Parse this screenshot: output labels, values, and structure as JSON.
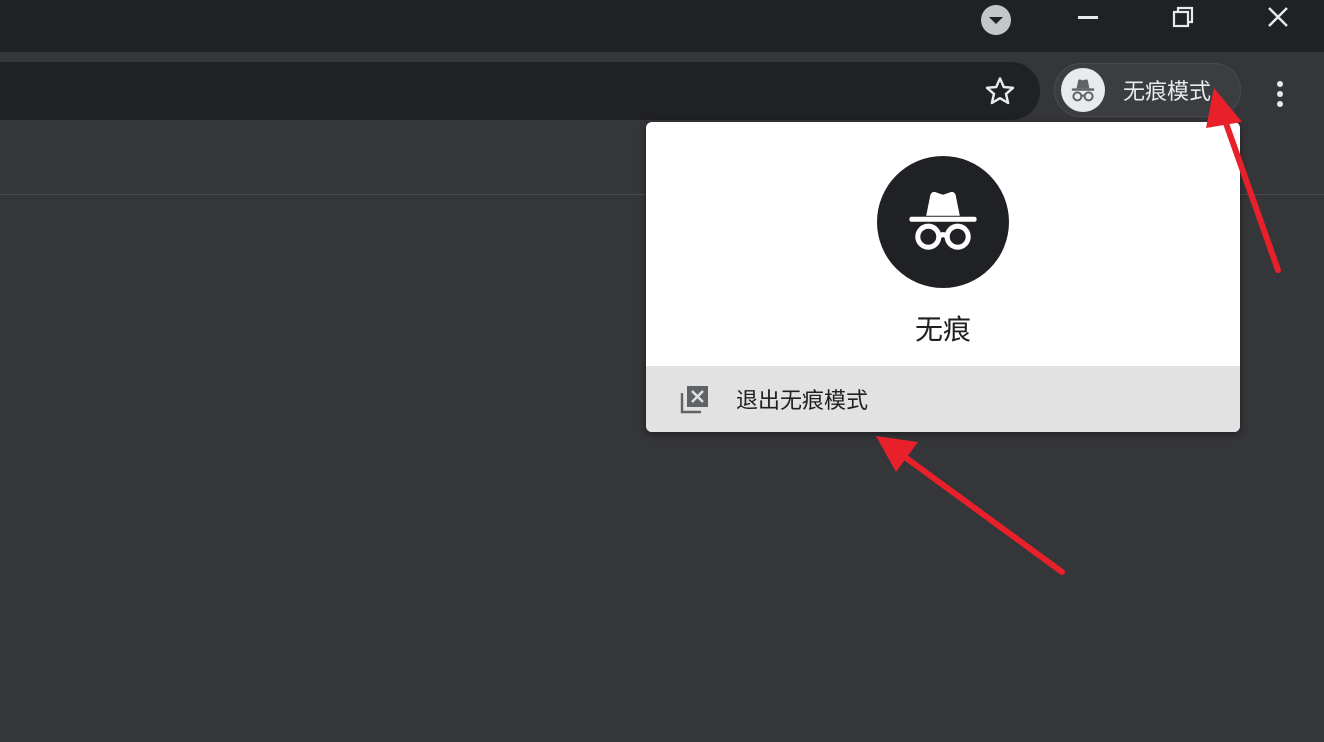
{
  "window": {
    "tab_search_icon": "tab-search-icon",
    "minimize_icon": "minimize-icon",
    "restore_icon": "restore-icon",
    "close_icon": "close-icon"
  },
  "toolbar": {
    "bookmark_icon": "star-icon",
    "profile": {
      "icon": "incognito-icon",
      "label": "无痕模式"
    },
    "menu_icon": "more-vertical-icon"
  },
  "popup": {
    "avatar_icon": "incognito-icon",
    "name": "无痕",
    "exit_item": {
      "icon": "close-window-icon",
      "label": "退出无痕模式"
    }
  },
  "annotations": {
    "arrow_color": "#e8202a"
  },
  "colors": {
    "titlebar": "#202124",
    "toolbar": "#35363a",
    "omnibox": "#202124",
    "popup_bg": "#ffffff",
    "popup_exit_bg": "#e2e2e2"
  }
}
